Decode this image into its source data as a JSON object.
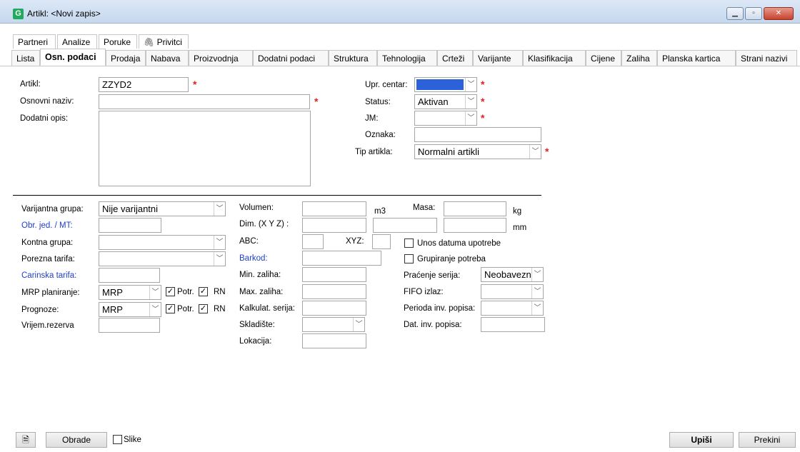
{
  "window": {
    "title": "Artikl: <Novi zapis>",
    "icon_letter": "G"
  },
  "top_tabs": [
    "Partneri",
    "Analize",
    "Poruke",
    "Privitci"
  ],
  "tabs": [
    "Lista",
    "Osn. podaci",
    "Prodaja",
    "Nabava",
    "Proizvodnja",
    "Dodatni podaci",
    "Struktura",
    "Tehnologija",
    "Crteži",
    "Varijante",
    "Klasifikacija",
    "Cijene",
    "Zaliha",
    "Planska kartica",
    "Strani nazivi"
  ],
  "active_tab": "Osn. podaci",
  "form": {
    "artikl": {
      "label": "Artikl:",
      "value": "ZZYD2"
    },
    "osnovni_naziv": {
      "label": "Osnovni naziv:",
      "value": ""
    },
    "dodatni_opis": {
      "label": "Dodatni opis:",
      "value": ""
    },
    "upr_centar": {
      "label": "Upr. centar:",
      "value": ""
    },
    "status": {
      "label": "Status:",
      "value": "Aktivan"
    },
    "jm": {
      "label": "JM:",
      "value": ""
    },
    "oznaka": {
      "label": "Oznaka:",
      "value": ""
    },
    "tip_artikla": {
      "label": "Tip artikla:",
      "value": "Normalni artikli"
    }
  },
  "lower": {
    "varijantna_grupa": {
      "label": "Varijantna grupa:",
      "value": "Nije varijantni"
    },
    "obr_jed_mt": {
      "label": "Obr. jed. / MT:",
      "value": ""
    },
    "kontna_grupa": {
      "label": "Kontna grupa:",
      "value": ""
    },
    "porezna_tarifa": {
      "label": "Porezna tarifa:",
      "value": ""
    },
    "carinska_tarifa": {
      "label": "Carinska tarifa:",
      "value": ""
    },
    "mrp_planiranje": {
      "label": "MRP planiranje:",
      "value": "MRP",
      "potr_label": "Potr.",
      "rn_label": "RN"
    },
    "prognoze": {
      "label": "Prognoze:",
      "value": "MRP",
      "potr_label": "Potr.",
      "rn_label": "RN"
    },
    "vrijem_rezerva": {
      "label": "Vrijem.rezerva",
      "value": ""
    },
    "volumen": {
      "label": "Volumen:",
      "unit": "m3",
      "value": ""
    },
    "masa": {
      "label": "Masa:",
      "unit": "kg",
      "value": ""
    },
    "dim": {
      "label": "Dim. (X Y Z) :",
      "unit": "mm"
    },
    "abc": {
      "label": "ABC:",
      "value": ""
    },
    "xyz": {
      "label": "XYZ:",
      "value": ""
    },
    "barkod": {
      "label": "Barkod:",
      "value": ""
    },
    "min_zaliha": {
      "label": "Min. zaliha:",
      "value": ""
    },
    "max_zaliha": {
      "label": "Max. zaliha:",
      "value": ""
    },
    "kalkulat_serija": {
      "label": "Kalkulat. serija:",
      "value": ""
    },
    "skladiste": {
      "label": "Skladište:",
      "value": ""
    },
    "lokacija": {
      "label": "Lokacija:",
      "value": ""
    },
    "unos_datuma": {
      "label": "Unos datuma upotrebe"
    },
    "grupiranje": {
      "label": "Grupiranje potreba"
    },
    "pracenje_serija": {
      "label": "Praćenje serija:",
      "value": "Neobavezn"
    },
    "fifo_izlaz": {
      "label": "FIFO izlaz:",
      "value": ""
    },
    "perioda_inv": {
      "label": "Perioda inv. popisa:",
      "value": ""
    },
    "dat_inv": {
      "label": "Dat. inv. popisa:",
      "value": ""
    }
  },
  "footer": {
    "obrade": "Obrade",
    "slike": "Slike",
    "upisi": "Upiši",
    "prekini": "Prekini"
  }
}
